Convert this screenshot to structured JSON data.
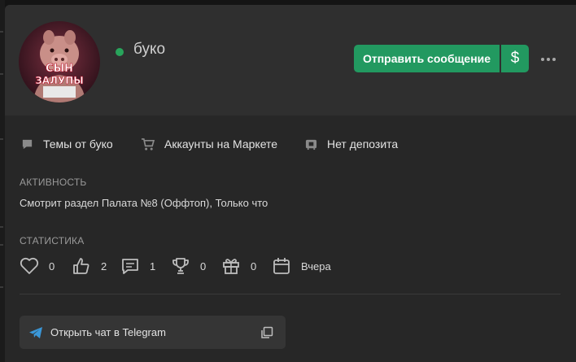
{
  "profile": {
    "username": "буко",
    "avatar_caption_line1": "СЫН",
    "avatar_caption_line2": "ЗАЛУПЫ",
    "status": "online"
  },
  "actions": {
    "send_message": "Отправить сообщение",
    "money_symbol": "$",
    "more_icon": "more-horizontal-icon"
  },
  "links": [
    {
      "label": "Темы от буко",
      "icon": "chat-bubble-icon"
    },
    {
      "label": "Аккаунты на Маркете",
      "icon": "cart-icon"
    },
    {
      "label": "Нет депозита",
      "icon": "wallet-icon"
    }
  ],
  "activity": {
    "title": "АКТИВНОСТЬ",
    "text": "Смотрит раздел Палата №8 (Оффтоп), Только что"
  },
  "statistics": {
    "title": "СТАТИСТИКА",
    "items": [
      {
        "icon": "heart-icon",
        "value": "0"
      },
      {
        "icon": "thumbs-up-icon",
        "value": "2"
      },
      {
        "icon": "message-icon",
        "value": "1"
      },
      {
        "icon": "trophy-icon",
        "value": "0"
      },
      {
        "icon": "gift-icon",
        "value": "0"
      },
      {
        "icon": "calendar-icon",
        "value": "Вчера"
      }
    ]
  },
  "telegram": {
    "label": "Открыть чат в Telegram",
    "icon": "telegram-icon",
    "copy_icon": "copy-icon"
  },
  "colors": {
    "accent": "#229960",
    "online": "#28a45b",
    "card": "#272727",
    "header": "#2f2f2f"
  }
}
